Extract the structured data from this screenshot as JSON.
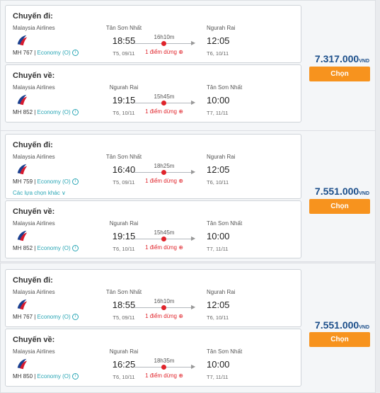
{
  "results": [
    {
      "price": "7.317.000",
      "currency": "VND",
      "button": "Chọn",
      "legs": [
        {
          "title": "Chuyến đi:",
          "airline": "Malaysia Airlines",
          "flight": "MH 767",
          "cabin": "Economy (O)",
          "from": "Tân Sơn Nhất",
          "dep_time": "18:55",
          "dep_date": "T5, 09/11",
          "duration": "16h10m",
          "stops": "1 điểm dừng",
          "to": "Ngurah Rai",
          "arr_time": "12:05",
          "arr_date": "T6, 10/11",
          "more": ""
        },
        {
          "title": "Chuyến về:",
          "airline": "Malaysia Airlines",
          "flight": "MH 852",
          "cabin": "Economy (O)",
          "from": "Ngurah Rai",
          "dep_time": "19:15",
          "dep_date": "T6, 10/11",
          "duration": "15h45m",
          "stops": "1 điểm dừng",
          "to": "Tân Sơn Nhất",
          "arr_time": "10:00",
          "arr_date": "T7, 11/11",
          "more": ""
        }
      ]
    },
    {
      "price": "7.551.000",
      "currency": "VND",
      "button": "Chọn",
      "legs": [
        {
          "title": "Chuyến đi:",
          "airline": "Malaysia Airlines",
          "flight": "MH 759",
          "cabin": "Economy (O)",
          "from": "Tân Sơn Nhất",
          "dep_time": "16:40",
          "dep_date": "T5, 09/11",
          "duration": "18h25m",
          "stops": "1 điểm dừng",
          "to": "Ngurah Rai",
          "arr_time": "12:05",
          "arr_date": "T6, 10/11",
          "more": "Các lựa chọn khác ∨"
        },
        {
          "title": "Chuyến về:",
          "airline": "Malaysia Airlines",
          "flight": "MH 852",
          "cabin": "Economy (O)",
          "from": "Ngurah Rai",
          "dep_time": "19:15",
          "dep_date": "T6, 10/11",
          "duration": "15h45m",
          "stops": "1 điểm dừng",
          "to": "Tân Sơn Nhất",
          "arr_time": "10:00",
          "arr_date": "T7, 11/11",
          "more": ""
        }
      ]
    },
    {
      "price": "7.551.000",
      "currency": "VND",
      "button": "Chọn",
      "legs": [
        {
          "title": "Chuyến đi:",
          "airline": "Malaysia Airlines",
          "flight": "MH 767",
          "cabin": "Economy (O)",
          "from": "Tân Sơn Nhất",
          "dep_time": "18:55",
          "dep_date": "T5, 09/11",
          "duration": "16h10m",
          "stops": "1 điểm dừng",
          "to": "Ngurah Rai",
          "arr_time": "12:05",
          "arr_date": "T6, 10/11",
          "more": ""
        },
        {
          "title": "Chuyến về:",
          "airline": "Malaysia Airlines",
          "flight": "MH 850",
          "cabin": "Economy (O)",
          "from": "Ngurah Rai",
          "dep_time": "16:25",
          "dep_date": "T6, 10/11",
          "duration": "18h35m",
          "stops": "1 điểm dừng",
          "to": "Tân Sơn Nhất",
          "arr_time": "10:00",
          "arr_date": "T7, 11/11",
          "more": ""
        }
      ]
    }
  ]
}
